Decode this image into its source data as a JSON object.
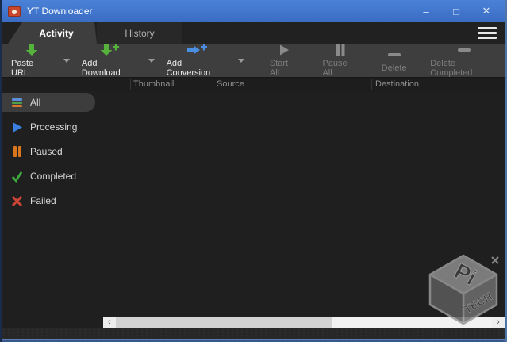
{
  "window": {
    "title": "YT Downloader",
    "controls": {
      "minimize": "–",
      "maximize": "□",
      "close": "✕"
    }
  },
  "tabs": {
    "activity": "Activity",
    "history": "History"
  },
  "toolbar": {
    "paste_url": "Paste URL",
    "add_download": "Add Download",
    "add_conversion": "Add Conversion",
    "start_all": "Start All",
    "pause_all": "Pause All",
    "delete": "Delete",
    "delete_completed": "Delete Completed"
  },
  "columns": {
    "thumbnail": "Thumbnail",
    "source": "Source",
    "destination": "Destination"
  },
  "sidebar": {
    "all": "All",
    "processing": "Processing",
    "paused": "Paused",
    "completed": "Completed",
    "failed": "Failed"
  },
  "scrollbar": {
    "left_arrow": "‹",
    "right_arrow": "›"
  },
  "watermark": {
    "top": "Pi",
    "side": "TECH"
  },
  "colors": {
    "titlebar_blue": "#3d72c9",
    "toolbar_gray": "#3e3e3e",
    "content_dark": "#1f1f1f",
    "accent_green": "#55b23a",
    "accent_blue": "#4a8fe2",
    "processing_blue": "#3b7fe0",
    "paused_orange": "#d9771e",
    "completed_green": "#3fa83f",
    "failed_red": "#cc4436"
  }
}
